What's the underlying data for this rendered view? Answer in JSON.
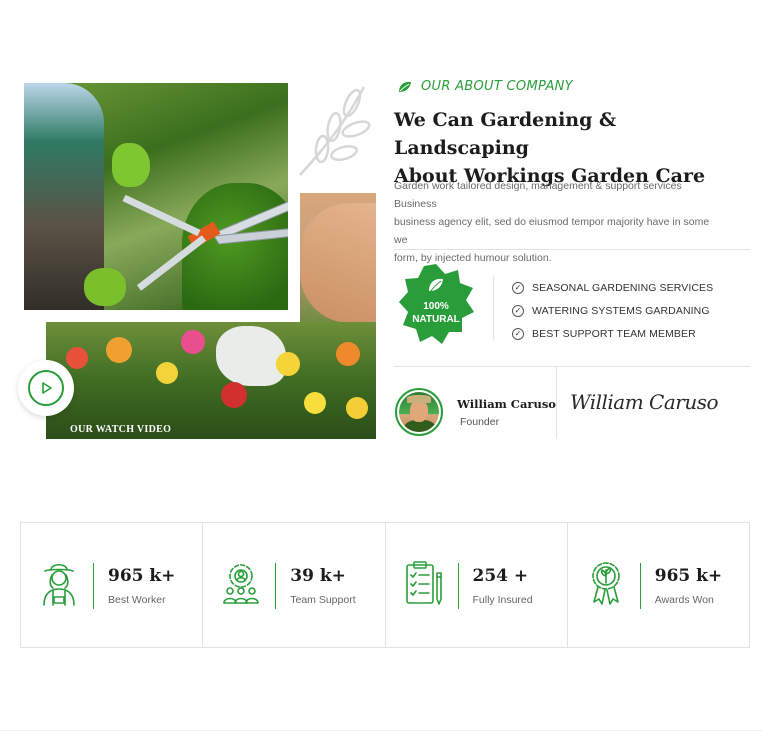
{
  "colors": {
    "accent": "#2a9d3b",
    "heading": "#1c1c1c",
    "text": "#6a6a6a",
    "border": "#e2e2e2"
  },
  "about": {
    "subtitle": "OUR ABOUT COMPANY",
    "subtitle_icon": "leaf-icon",
    "headline_line1": "We Can Gardening & Landscaping",
    "headline_line2": "About Workings Garden Care",
    "description_line1": "Garden work tailored design, management & support services Business",
    "description_line2": "business agency elit, sed do eiusmod tempor majority have in some we",
    "description_line3": "form, by injected humour solution.",
    "badge_line1": "100%",
    "badge_line2": "NATURAL",
    "features": [
      "SEASONAL GARDENING SERVICES",
      "WATERING SYSTEMS GARDANING",
      "BEST SUPPORT TEAM MEMBER"
    ],
    "person_name": "William Caruso",
    "person_role": "Founder",
    "signature": "William Caruso"
  },
  "video": {
    "label": "OUR WATCH VIDEO"
  },
  "stats": [
    {
      "value": "965 k+",
      "label": "Best Worker",
      "icon": "gardener-icon"
    },
    {
      "value": "39 k+",
      "label": "Team Support",
      "icon": "team-gear-icon"
    },
    {
      "value": "254 +",
      "label": "Fully Insured",
      "icon": "clipboard-icon"
    },
    {
      "value": "965 k+",
      "label": "Awards Won",
      "icon": "award-ribbon-icon"
    }
  ]
}
